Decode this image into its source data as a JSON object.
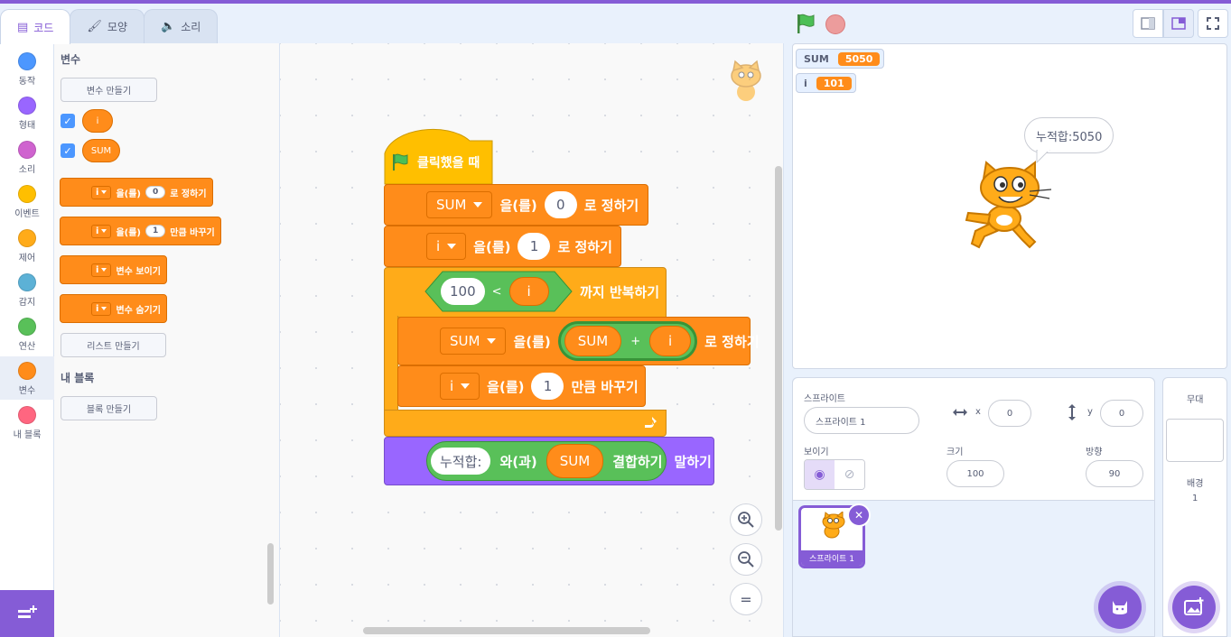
{
  "tabs": [
    {
      "label": "코드",
      "icon": "code-icon"
    },
    {
      "label": "모양",
      "icon": "brush-icon"
    },
    {
      "label": "소리",
      "icon": "speaker-icon"
    }
  ],
  "categories": [
    {
      "label": "동작",
      "color": "#4c97ff"
    },
    {
      "label": "형태",
      "color": "#9966ff"
    },
    {
      "label": "소리",
      "color": "#cf63cf"
    },
    {
      "label": "이벤트",
      "color": "#ffbf00"
    },
    {
      "label": "제어",
      "color": "#ffab19"
    },
    {
      "label": "감지",
      "color": "#5cb1d6"
    },
    {
      "label": "연산",
      "color": "#59c059"
    },
    {
      "label": "변수",
      "color": "#ff8c1a"
    },
    {
      "label": "내 블록",
      "color": "#ff6680"
    }
  ],
  "palette": {
    "variables_title": "변수",
    "make_variable": "변수 만들기",
    "var_i": "i",
    "var_sum": "SUM",
    "set_block": {
      "dropdown": "i",
      "text1": "을(를)",
      "value": "0",
      "text2": "로 정하기"
    },
    "change_block": {
      "dropdown": "i",
      "text1": "을(를)",
      "value": "1",
      "text2": "만큼 바꾸기"
    },
    "show_block": {
      "dropdown": "i",
      "text": "변수 보이기"
    },
    "hide_block": {
      "dropdown": "i",
      "text": "변수 숨기기"
    },
    "make_list": "리스트 만들기",
    "my_blocks_title": "내 블록",
    "make_block": "블록 만들기"
  },
  "script": {
    "hat": "클릭했을 때",
    "set_sum": {
      "var": "SUM",
      "text1": "을(를)",
      "value": "0",
      "text2": "로 정하기"
    },
    "set_i": {
      "var": "i",
      "text1": "을(를)",
      "value": "1",
      "text2": "로 정하기"
    },
    "repeat": {
      "left": "100",
      "op": "<",
      "right": "i",
      "text": "까지 반복하기"
    },
    "set_sum2": {
      "var": "SUM",
      "text1": "을(를)",
      "a": "SUM",
      "op": "+",
      "b": "i",
      "text2": "로 정하기"
    },
    "change_i": {
      "var": "i",
      "text1": "을(를)",
      "value": "1",
      "text2": "만큼 바꾸기"
    },
    "say": {
      "text": "누적합:",
      "join_text": "와(과)",
      "var": "SUM",
      "join_end": "결합하기",
      "say": "말하기"
    }
  },
  "zoom": {
    "in": "+",
    "out": "−",
    "reset": "="
  },
  "stage": {
    "monitors": [
      {
        "name": "SUM",
        "value": "5050"
      },
      {
        "name": "i",
        "value": "101"
      }
    ],
    "speech": "누적합:5050"
  },
  "sprite_info": {
    "sprite_label": "스프라이트",
    "sprite_name": "스프라이트 1",
    "x_label": "x",
    "x": "0",
    "y_label": "y",
    "y": "0",
    "show_label": "보이기",
    "size_label": "크기",
    "size": "100",
    "direction_label": "방향",
    "direction": "90"
  },
  "sprite_list": [
    {
      "name": "스프라이트 1"
    }
  ],
  "backdrop_pane": {
    "title": "무대",
    "backdrop_label": "배경",
    "count": "1"
  }
}
